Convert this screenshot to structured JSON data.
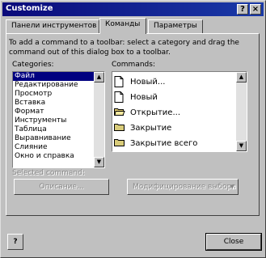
{
  "window": {
    "title": "Customize",
    "help_label": "?",
    "close_label": "×"
  },
  "tabs": [
    {
      "label": "Панели инструментов"
    },
    {
      "label": "Команды"
    },
    {
      "label": "Параметры"
    }
  ],
  "instructions": "To add a command to a toolbar: select a category and drag the command out of this dialog box to a toolbar.",
  "categories": {
    "label": "Categories:",
    "items": [
      "Файл",
      "Редактирование",
      "Просмотр",
      "Вставка",
      "Формат",
      "Инструменты",
      "Таблица",
      "Выравнивание",
      "Слияние",
      "Окно и справка"
    ],
    "selected": "Файл"
  },
  "commands": {
    "label": "Commands:",
    "items": [
      {
        "label": "Новый...",
        "icon": "new-document-icon"
      },
      {
        "label": "Новый",
        "icon": "new-document-icon"
      },
      {
        "label": "Открытие...",
        "icon": "open-folder-icon"
      },
      {
        "label": "Закрытие",
        "icon": "folder-icon"
      },
      {
        "label": "Закрытие всего",
        "icon": "folder-icon"
      }
    ]
  },
  "selected_command": {
    "label": "Selected command:",
    "description_button": "Описание...",
    "modify_button": "Модифицирование выбора"
  },
  "help_button_label": "?",
  "close_button": "Close"
}
